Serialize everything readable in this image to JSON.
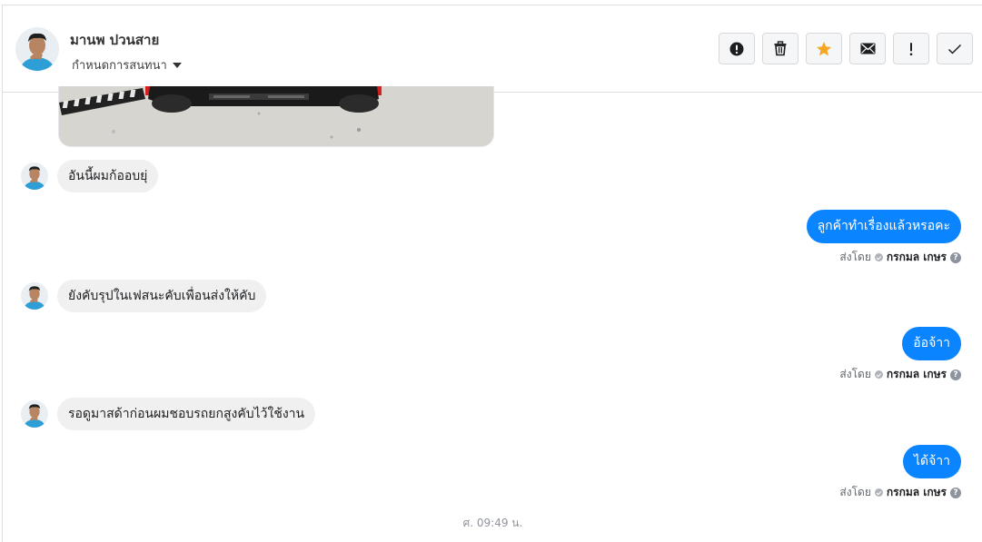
{
  "header": {
    "name": "มานพ ปวนสาย",
    "assign_label": "กำหนดการสนทนา"
  },
  "actions": [
    {
      "icon": "alert-circle-icon",
      "label": "spam"
    },
    {
      "icon": "trash-icon",
      "label": "delete"
    },
    {
      "icon": "star-icon",
      "label": "star",
      "color": "#f5a623"
    },
    {
      "icon": "envelope-icon",
      "label": "unread"
    },
    {
      "icon": "exclamation-icon",
      "label": "follow up"
    },
    {
      "icon": "check-icon",
      "label": "done"
    }
  ],
  "messages": [
    {
      "from": "customer",
      "text": "อันนี้ผมก้ออบยุ่"
    },
    {
      "from": "page",
      "text": "ลูกค้าทำเรื่องแล้วหรอคะ",
      "sent_prefix": "ส่งโดย",
      "sender": "กรกมล เกษร"
    },
    {
      "from": "customer",
      "text": "ยังคับรุปในเฟสนะคับเพื่อนส่งให้คับ"
    },
    {
      "from": "page",
      "text": "อ้อจ้าา",
      "sent_prefix": "ส่งโดย",
      "sender": "กรกมล เกษร"
    },
    {
      "from": "customer",
      "text": "รอดูมาสด้าก่อนผมชอบรถยกสูงคับไว้ใช้งาน"
    },
    {
      "from": "page",
      "text": "ได้จ้าา",
      "sent_prefix": "ส่งโดย",
      "sender": "กรกมล เกษร"
    }
  ],
  "timestamp": "ศ. 09:49 น.",
  "colors": {
    "outgoing_bubble": "#0a84ff",
    "incoming_bubble": "#f0f0f0"
  }
}
